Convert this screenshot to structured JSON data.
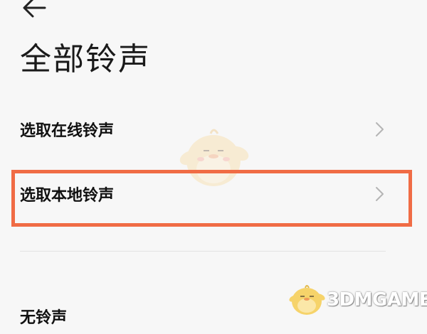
{
  "header": {
    "back_icon": "arrow-left-icon",
    "title": "全部铃声"
  },
  "options": {
    "online": {
      "label": "选取在线铃声",
      "icon": "chevron-right-icon"
    },
    "local": {
      "label": "选取本地铃声",
      "icon": "chevron-right-icon",
      "highlighted": true
    },
    "none": {
      "label": "无铃声"
    }
  },
  "colors": {
    "background": "#f7f7f7",
    "highlight_border": "#f06c45",
    "text": "#111111",
    "chevron": "#b5b5b5"
  },
  "watermark": {
    "text": "3DMGAME",
    "mascot_icon": "duck-mascot-icon"
  }
}
